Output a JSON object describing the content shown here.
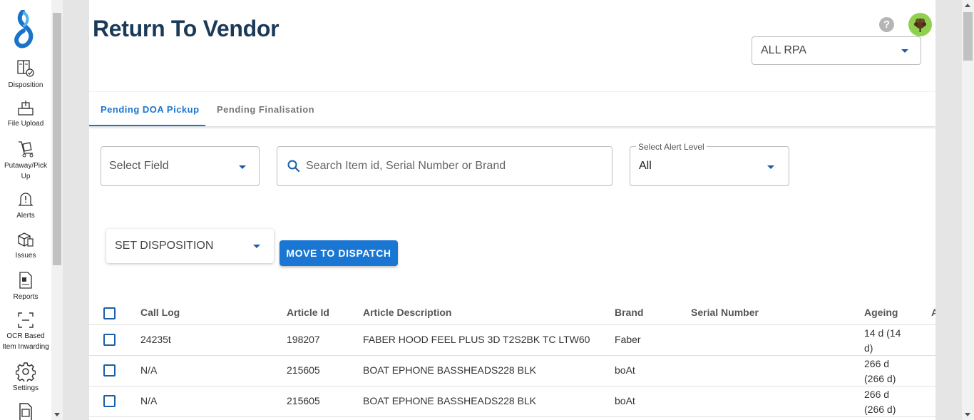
{
  "sidebar": {
    "items": [
      {
        "label": "Disposition",
        "icon": "disposition-icon"
      },
      {
        "label": "File Upload",
        "icon": "file-upload-icon"
      },
      {
        "label": "Putaway/Pick Up",
        "icon": "putaway-icon"
      },
      {
        "label": "Alerts",
        "icon": "alert-bell-icon"
      },
      {
        "label": "Issues",
        "icon": "issues-icon"
      },
      {
        "label": "Reports",
        "icon": "reports-icon"
      },
      {
        "label": "OCR Based Item Inwarding",
        "icon": "ocr-scan-icon"
      },
      {
        "label": "Settings",
        "icon": "gear-icon"
      }
    ]
  },
  "header": {
    "title": "Return To Vendor",
    "help": "?",
    "rpa_select": "ALL RPA"
  },
  "tabs": [
    {
      "label": "Pending DOA Pickup",
      "active": true
    },
    {
      "label": "Pending Finalisation",
      "active": false
    }
  ],
  "filters": {
    "select_field": "Select Field",
    "search_placeholder": "Search Item id, Serial Number or Brand",
    "alert_label": "Select Alert Level",
    "alert_value": "All"
  },
  "actions": {
    "set_disposition": "SET DISPOSITION",
    "move_to_dispatch": "MOVE TO DISPATCH"
  },
  "table": {
    "columns": [
      "Call Log",
      "Article Id",
      "Article Description",
      "Brand",
      "Serial Number",
      "Ageing",
      "A"
    ],
    "rows": [
      {
        "call_log": "24235t",
        "article_id": "198207",
        "description": "FABER HOOD FEEL PLUS 3D T2S2BK TC LTW60",
        "brand": "Faber",
        "serial": "",
        "ageing": "14 d (14 d)"
      },
      {
        "call_log": "N/A",
        "article_id": "215605",
        "description": "BOAT EPHONE BASSHEADS228 BLK",
        "brand": "boAt",
        "serial": "",
        "ageing": "266 d (266 d)"
      },
      {
        "call_log": "N/A",
        "article_id": "215605",
        "description": "BOAT EPHONE BASSHEADS228 BLK",
        "brand": "boAt",
        "serial": "",
        "ageing": "266 d (266 d)"
      }
    ]
  },
  "colors": {
    "accent": "#1976d2",
    "title": "#1b3a57",
    "avatar_bg": "#8fd14f"
  }
}
